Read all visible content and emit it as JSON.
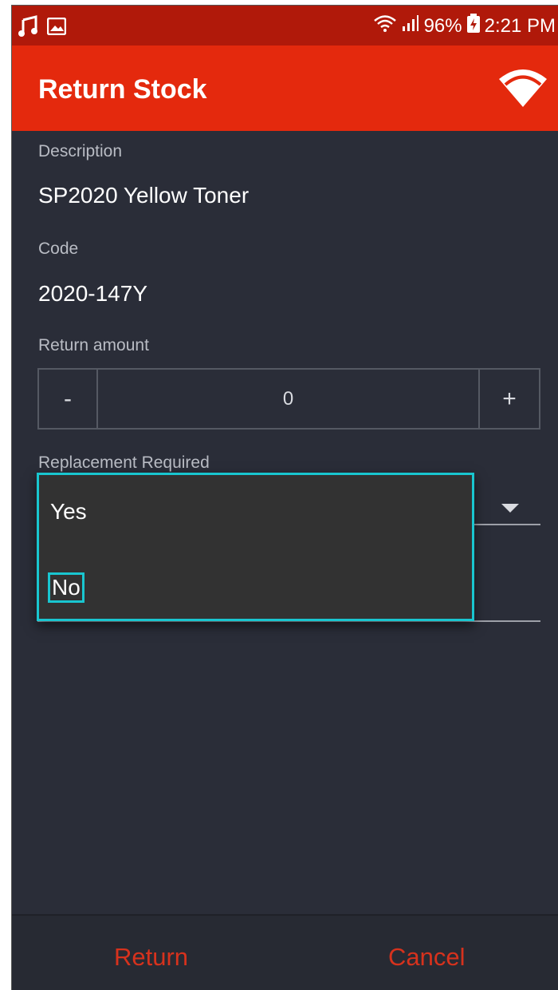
{
  "status_bar": {
    "battery_percent": "96%",
    "time": "2:21 PM",
    "icons": [
      "music-notification-icon",
      "image-notification-icon",
      "wifi-signal-icon",
      "cell-signal-icon",
      "battery-charging-icon"
    ]
  },
  "app_bar": {
    "title": "Return Stock",
    "icon": "wifi-icon"
  },
  "form": {
    "description_label": "Description",
    "description_value": "SP2020 Yellow Toner",
    "code_label": "Code",
    "code_value": "2020-147Y",
    "return_amount_label": "Return amount",
    "decrement_label": "-",
    "quantity": "0",
    "increment_label": "+",
    "replacement_label": "Replacement Required"
  },
  "dropdown": {
    "options": [
      "Yes",
      "No"
    ],
    "highlighted": "No"
  },
  "bottom_bar": {
    "return_label": "Return",
    "cancel_label": "Cancel"
  },
  "colors": {
    "status_bar": "#b0190a",
    "app_bar": "#e4290d",
    "background": "#2a2d38",
    "action_text": "#d6321d",
    "focus_outline": "#19c6d0"
  }
}
